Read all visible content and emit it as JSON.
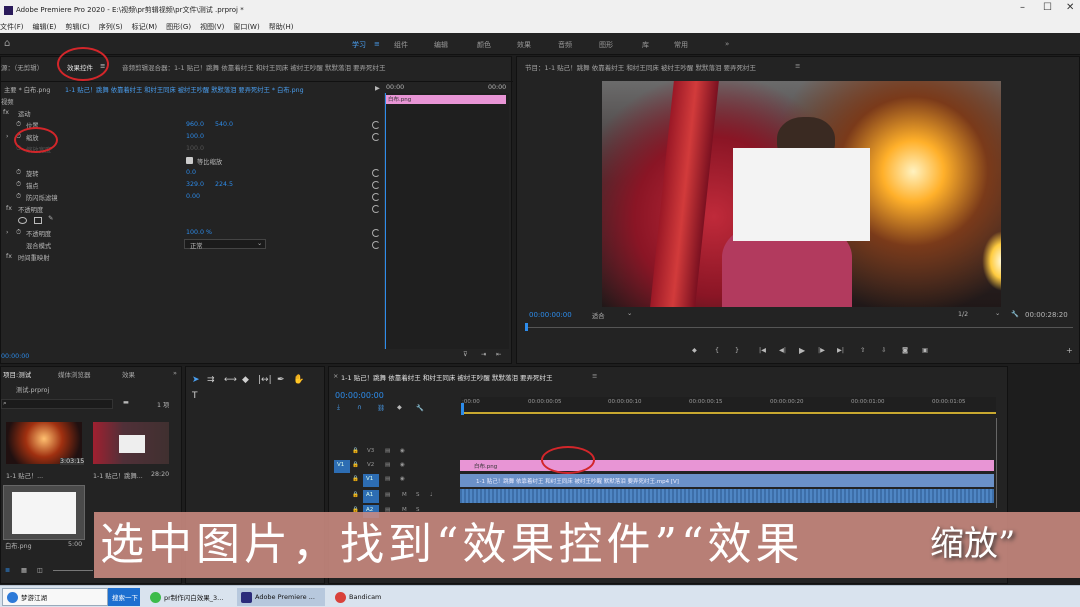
{
  "window": {
    "title": "Adobe Premiere Pro 2020 - E:\\视频\\pr剪辑视频\\pr文件\\测试 .prproj *",
    "minimize": "–",
    "maximize": "☐",
    "close": "✕"
  },
  "menu": [
    "文件(F)",
    "编辑(E)",
    "剪辑(C)",
    "序列(S)",
    "标记(M)",
    "图形(G)",
    "视图(V)",
    "窗口(W)",
    "帮助(H)"
  ],
  "workspaces": {
    "items": [
      "学习",
      "组件",
      "编辑",
      "颜色",
      "效果",
      "音频",
      "图形",
      "库",
      "常用"
    ],
    "more": "»"
  },
  "source_panel": {
    "tabs": [
      "源：（无剪辑）",
      "效果控件",
      "音频剪辑混合器：1-1 贴己！跳舞 依靠着纣王 和纣王同床 被纣王吵醒 默默落泪 要弄死纣王"
    ],
    "active_tab": "效果控件",
    "clip_label": "主要 * 白布.png",
    "seq_label": "1-1 贴己！跳舞 依靠着纣王 和纣王同床 被纣王吵醒 默默落泪 要弄死纣王 * 白布.png",
    "header_time_left": "00:00",
    "header_time_right": "00:00",
    "timeline_clip": "白布.png",
    "video_label": "视频",
    "motion": "运动",
    "properties": [
      {
        "name": "位置",
        "v1": "960.0",
        "v2": "540.0"
      },
      {
        "name": "缩放",
        "v1": "100.0",
        "v2": ""
      },
      {
        "name": "缩放宽度",
        "v1": "100.0",
        "v2": ""
      },
      {
        "name": "等比缩放",
        "v1": "",
        "v2": ""
      },
      {
        "name": "旋转",
        "v1": "0.0",
        "v2": ""
      },
      {
        "name": "锚点",
        "v1": "329.0",
        "v2": "224.5"
      },
      {
        "name": "防闪烁滤镜",
        "v1": "0.00",
        "v2": ""
      }
    ],
    "opacity": "不透明度",
    "opacity_value": {
      "name": "不透明度",
      "value": "100.0 %"
    },
    "blend_mode": {
      "name": "混合模式",
      "value": "正常"
    },
    "time_remap": "时间重映射",
    "bottom_time": "00:00:00"
  },
  "program_panel": {
    "title": "节目：1-1 贴己！跳舞 依靠着纣王 和纣王同床 被纣王吵醒 默默落泪 要弄死纣王",
    "timecode": "00:00:00:00",
    "fit": "适合",
    "quality": "1/2",
    "duration": "00:00:28:20"
  },
  "project_panel": {
    "tabs": [
      "项目:测试",
      "媒体浏览器",
      "效果"
    ],
    "file": "测试.prproj",
    "count": "1 项",
    "items": [
      {
        "name": "1-1 贴己！...",
        "duration": "3:03:15"
      },
      {
        "name": "1-1 贴己！跳舞...",
        "duration": "28:20"
      },
      {
        "name": "白布.png",
        "duration": "5:00"
      }
    ]
  },
  "timeline": {
    "title": "1-1 贴己！跳舞 依靠着纣王 和纣王同床 被纣王吵醒 默默落泪 要弄死纣王",
    "timecode": "00:00:00:00",
    "ruler": [
      ":00:00",
      "00:00:00:05",
      "00:00:00:10",
      "00:00:00:15",
      "00:00:00:20",
      "00:00:01:00",
      "00:00:01:05"
    ],
    "tracks": [
      "V3",
      "V2",
      "V1",
      "A1",
      "A2"
    ],
    "v2_clip": "白布.png",
    "v1_clip": "1-1 贴己！跳舞 依靠着纣王 和纣王同床 被纣王吵醒 默默落泪 要弄死纣王.mp4 [V]"
  },
  "caption": "选中图片，找到“效果控件”“效果",
  "caption_overlay": "缩放”",
  "taskbar": [
    {
      "label": "梦游江湖",
      "color": "#2d7ad8"
    },
    {
      "label": "搜索一下",
      "color": "#1d6fd0"
    },
    {
      "label": "pr制作闪白效果_3...",
      "color": "#3dbb4a"
    },
    {
      "label": "Adobe Premiere ...",
      "color": "#2b2b7a"
    },
    {
      "label": "Bandicam",
      "color": "#d9413a"
    }
  ]
}
